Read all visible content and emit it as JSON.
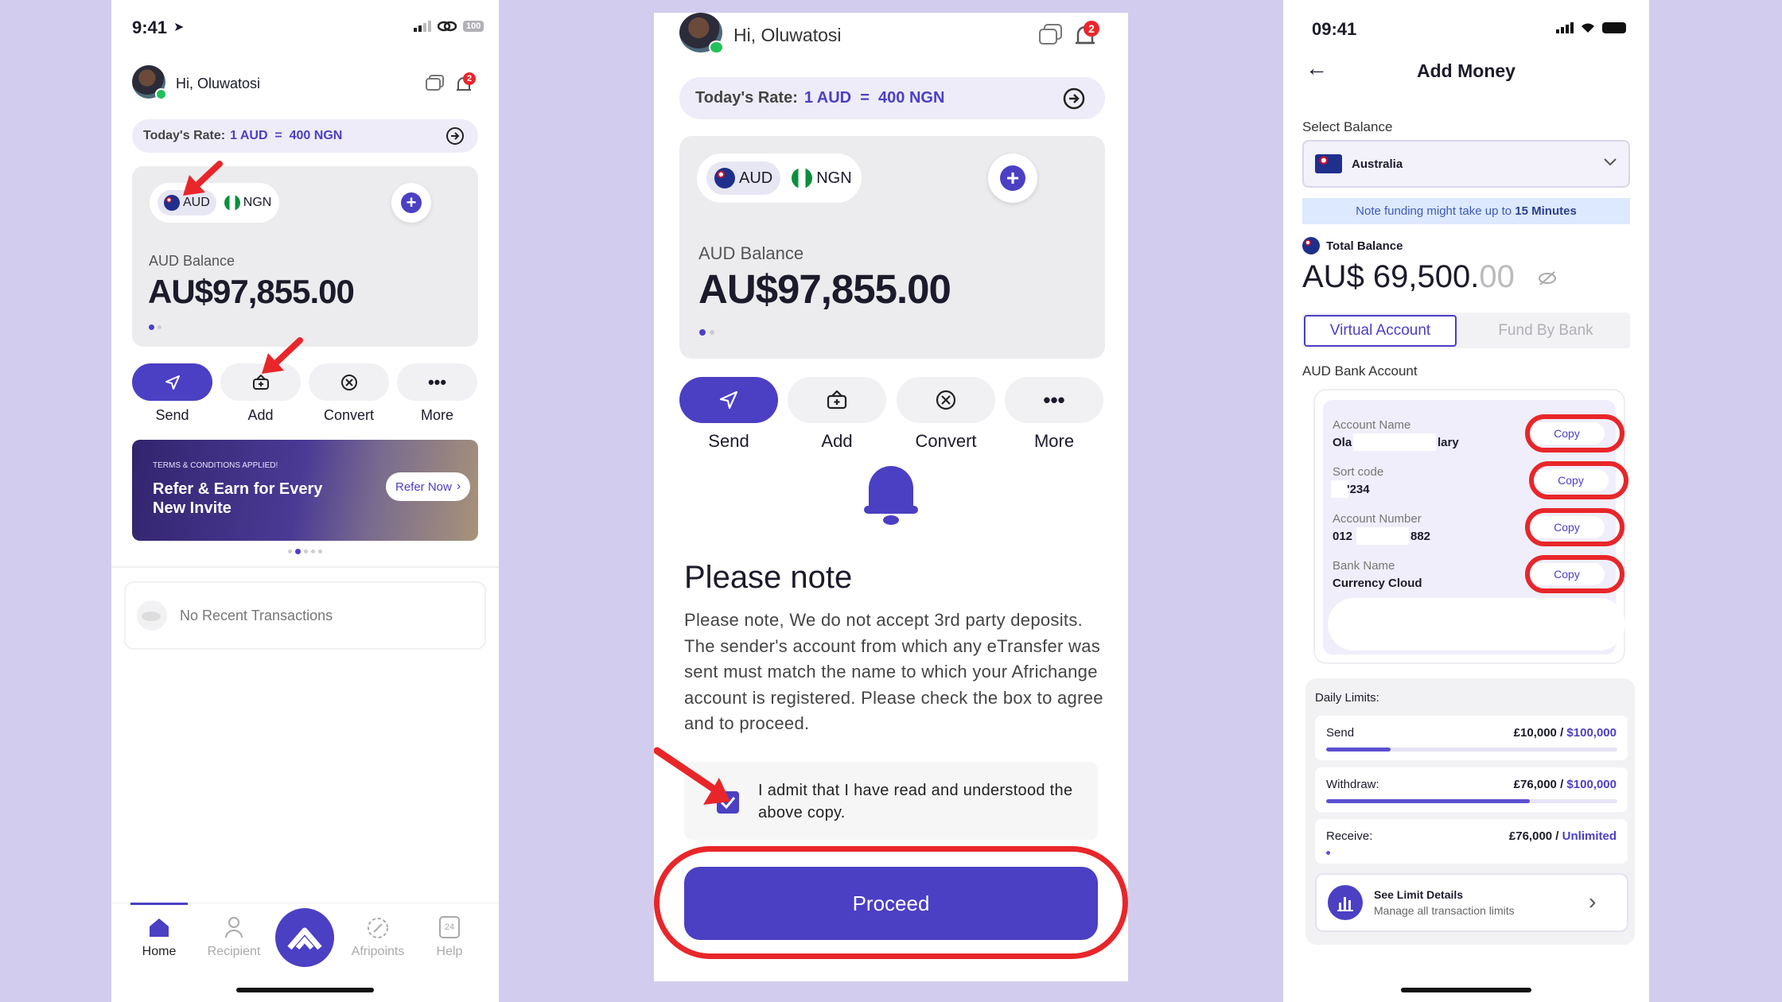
{
  "screen1": {
    "status_time": "9:41",
    "battery": "100",
    "greeting": "Hi, Oluwatosi",
    "notif_count": "2",
    "rate_label": "Today's Rate:",
    "rate_value": "1 AUD  =  400 NGN",
    "currencies": [
      "AUD",
      "NGN"
    ],
    "balance_label": "AUD Balance",
    "balance_value": "AU$97,855.00",
    "actions": [
      "Send",
      "Add",
      "Convert",
      "More"
    ],
    "promo": {
      "terms": "TERMS & CONDITIONS APPLIED!",
      "title": "Refer & Earn for Every New Invite",
      "cta": "Refer Now"
    },
    "no_transactions": "No Recent Transactions",
    "tabs": [
      "Home",
      "Recipient",
      "Afripoints",
      "Help"
    ]
  },
  "screen2": {
    "greeting": "Hi, Oluwatosi",
    "notif_count": "2",
    "rate_label": "Today's Rate:",
    "rate_value": "1 AUD  =  400 NGN",
    "currencies": [
      "AUD",
      "NGN"
    ],
    "balance_label": "AUD Balance",
    "balance_value": "AU$97,855.00",
    "actions": [
      "Send",
      "Add",
      "Convert",
      "More"
    ],
    "note_title": "Please note",
    "note_body": "Please note, We do not accept 3rd party deposits. The sender's account from which any eTransfer was sent must match the name to which your Africhange account is registered. Please check the box to agree and to proceed.",
    "agree_text": "I admit that I have read and understood the above copy.",
    "proceed": "Proceed"
  },
  "screen3": {
    "status_time": "09:41",
    "title": "Add Money",
    "select_balance_label": "Select Balance",
    "selected_balance": "Australia",
    "funding_note_prefix": "Note funding might take up to ",
    "funding_note_time": "15 Minutes",
    "total_balance_label": "Total Balance",
    "total_balance_main": "AU$ 69,500.",
    "total_balance_cents": "00",
    "tab_active": "Virtual Account",
    "tab_inactive": "Fund By Bank",
    "bank_section_label": "AUD Bank Account",
    "fields": [
      {
        "label": "Account Name",
        "value_start": "Ola",
        "value_end": "lary",
        "copy": "Copy"
      },
      {
        "label": "Sort code",
        "value_start": "",
        "value_end": "'234",
        "copy": "Copy"
      },
      {
        "label": "Account Number",
        "value_start": "012",
        "value_end": "882",
        "copy": "Copy"
      },
      {
        "label": "Bank Name",
        "value_start": "Currency Cloud",
        "value_end": "",
        "copy": "Copy"
      }
    ],
    "limits_title": "Daily Limits:",
    "limits": [
      {
        "label": "Send",
        "used": "£10,000",
        "sep": " / ",
        "max": "$100,000",
        "fraction": 0.22
      },
      {
        "label": "Withdraw:",
        "used": "£76,000",
        "sep": " / ",
        "max": "$100,000",
        "fraction": 0.7
      },
      {
        "label": "Receive:",
        "used": "£76,000",
        "sep": " / ",
        "max": "Unlimited",
        "fraction": 0.01
      }
    ],
    "limit_details_title": "See Limit Details",
    "limit_details_sub": "Manage all transaction limits"
  }
}
